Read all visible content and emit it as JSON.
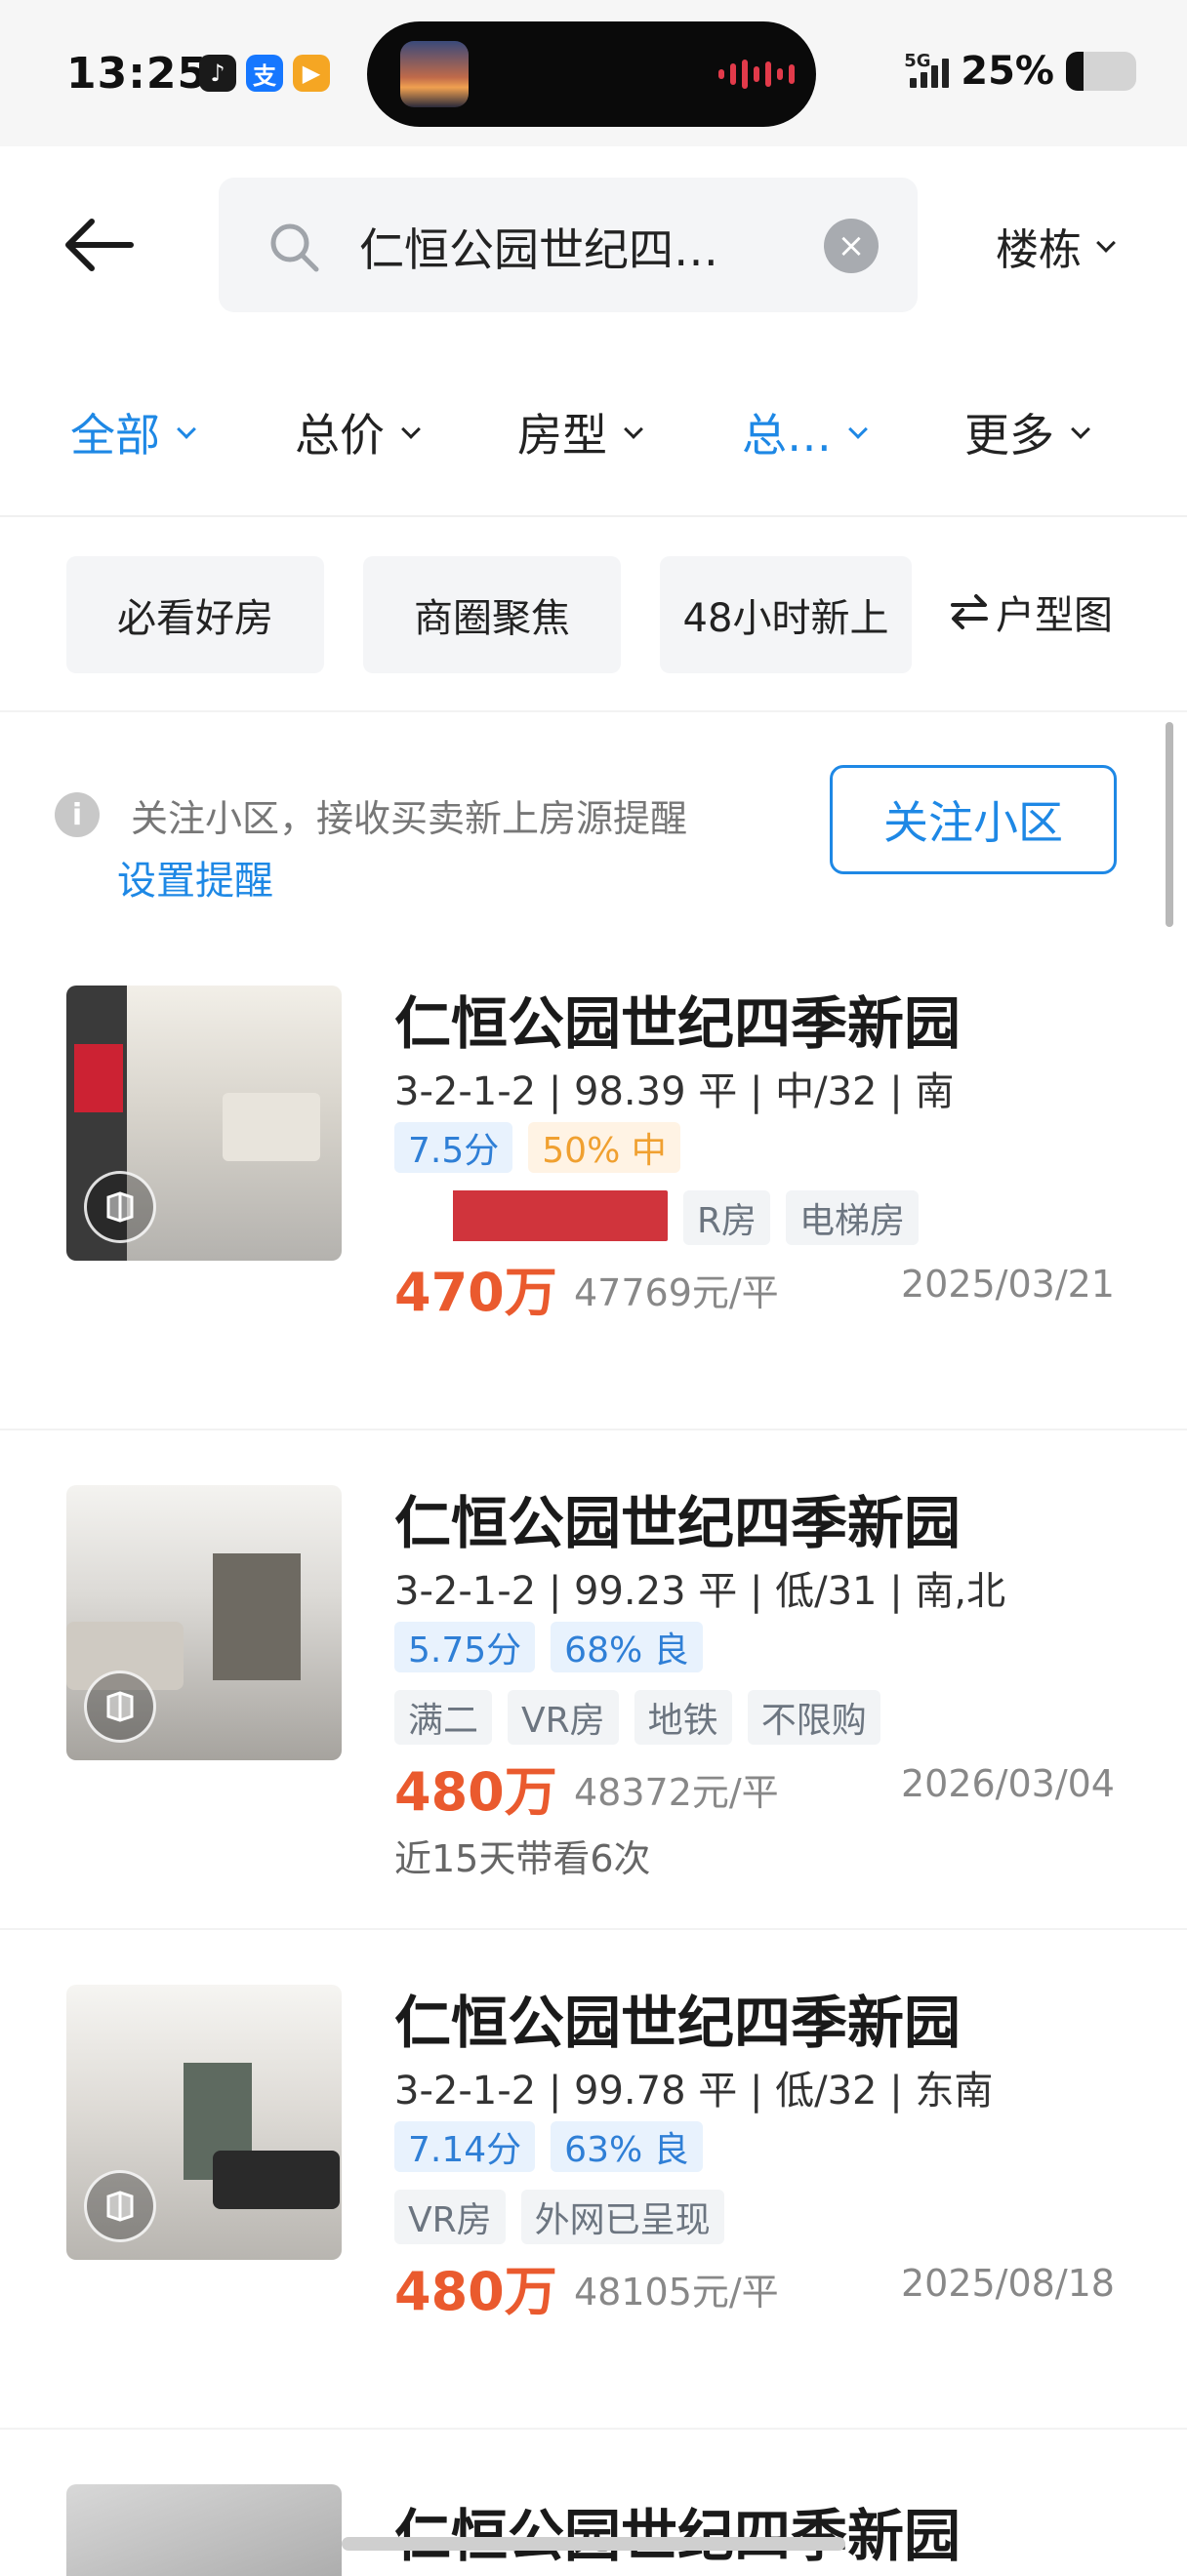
{
  "status_bar": {
    "time": "13:25",
    "network": "5G",
    "battery": "25%",
    "battery_level": 0.25,
    "apps": [
      {
        "icon": "music-app-icon",
        "color": "#1a1a1a",
        "glyph": "♪"
      },
      {
        "icon": "alipay-icon",
        "color": "#1677ff",
        "glyph": "支"
      },
      {
        "icon": "video-app-icon",
        "color": "#f5a623",
        "glyph": "▶"
      }
    ]
  },
  "search": {
    "query": "仁恒公园世纪四…",
    "building_filter": "楼栋"
  },
  "filters": [
    {
      "label": "全部",
      "active": true
    },
    {
      "label": "总价",
      "active": false
    },
    {
      "label": "房型",
      "active": false
    },
    {
      "label": "总…",
      "active": true
    },
    {
      "label": "更多",
      "active": false
    }
  ],
  "quick_tags": [
    "必看好房",
    "商圈聚焦",
    "48小时新上"
  ],
  "floorplan_label": "户型图",
  "follow_banner": {
    "text": "关注小区，接收买卖新上房源提醒",
    "link": "设置提醒",
    "button": "关注小区"
  },
  "listings": [
    {
      "title": "仁恒公园世纪四季新园",
      "detail": "3-2-1-2 | 98.39 平 | 中/32 | 南",
      "score": "7.5分",
      "rating": "50% 中",
      "rating_style": "orange",
      "tags": [
        "R房",
        "电梯房"
      ],
      "redacted": true,
      "price": "470万",
      "unit_price": "47769元/平",
      "date": "2025/03/21",
      "note": ""
    },
    {
      "title": "仁恒公园世纪四季新园",
      "detail": "3-2-1-2 | 99.23 平 | 低/31 | 南,北",
      "score": "5.75分",
      "rating": "68% 良",
      "rating_style": "blue",
      "tags": [
        "满二",
        "VR房",
        "地铁",
        "不限购"
      ],
      "redacted": false,
      "price": "480万",
      "unit_price": "48372元/平",
      "date": "2026/03/04",
      "note": "近15天带看6次"
    },
    {
      "title": "仁恒公园世纪四季新园",
      "detail": "3-2-1-2 | 99.78 平 | 低/32 | 东南",
      "score": "7.14分",
      "rating": "63% 良",
      "rating_style": "blue",
      "tags": [
        "VR房",
        "外网已呈现"
      ],
      "redacted": false,
      "price": "480万",
      "unit_price": "48105元/平",
      "date": "2025/08/18",
      "note": ""
    }
  ],
  "partial_listing_title": "仁恒公园世纪四季新园",
  "colors": {
    "accent": "#1e88e5",
    "price": "#ea5a2e"
  }
}
